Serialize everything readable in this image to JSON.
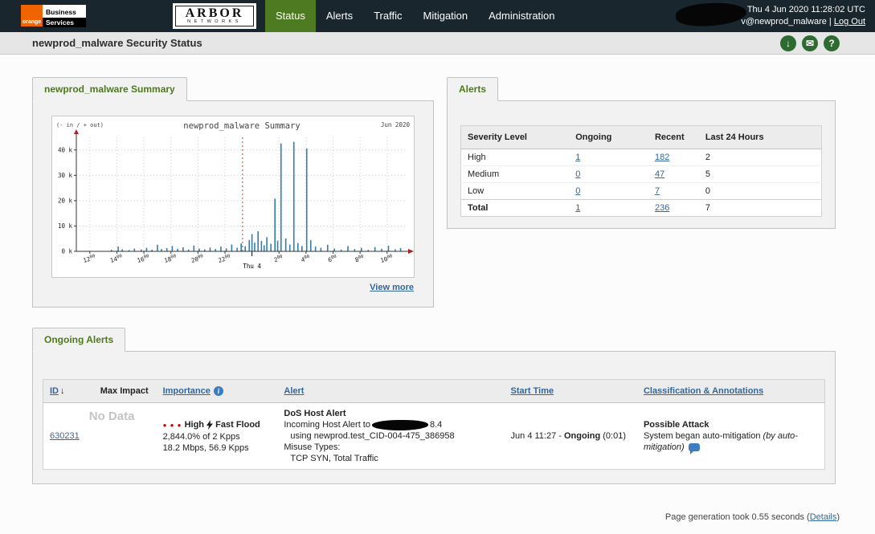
{
  "topbar": {
    "brand": {
      "orange": "orange",
      "business": "Business",
      "services": "Services"
    },
    "arbor": {
      "name": "ARBOR",
      "sub": "NETWORKS"
    },
    "nav": [
      {
        "label": "Status",
        "active": true
      },
      {
        "label": "Alerts",
        "active": false
      },
      {
        "label": "Traffic",
        "active": false
      },
      {
        "label": "Mitigation",
        "active": false
      },
      {
        "label": "Administration",
        "active": false
      }
    ],
    "datetime": "Thu 4 Jun 2020 11:28:02 UTC",
    "user": "v@newprod_malware",
    "separator": " | ",
    "logout": "Log Out"
  },
  "header": {
    "title": "newprod_malware Security Status",
    "icons": [
      {
        "name": "download",
        "glyph": "↓"
      },
      {
        "name": "mail",
        "glyph": "✉"
      },
      {
        "name": "help",
        "glyph": "?"
      }
    ]
  },
  "summary_panel": {
    "tab": "newprod_malware Summary",
    "view_more": "View more"
  },
  "alerts_panel": {
    "tab": "Alerts",
    "headers": [
      "Severity Level",
      "Ongoing",
      "Recent",
      "Last 24 Hours"
    ],
    "rows": [
      {
        "severity": "High",
        "ongoing": "1",
        "recent": "182",
        "last24": "2"
      },
      {
        "severity": "Medium",
        "ongoing": "0",
        "recent": "47",
        "last24": "5"
      },
      {
        "severity": "Low",
        "ongoing": "0",
        "recent": "7",
        "last24": "0"
      },
      {
        "severity": "Total",
        "ongoing": "1",
        "recent": "236",
        "last24": "7"
      }
    ]
  },
  "ongoing_panel": {
    "tab": "Ongoing Alerts",
    "headers": {
      "id": "ID",
      "sort": "↓",
      "max_impact": "Max Impact",
      "importance": "Importance",
      "alert": "Alert",
      "start_time": "Start Time",
      "classification": "Classification & Annotations"
    },
    "row": {
      "id": "630231",
      "max_impact": "No Data",
      "dots": "● ● ●",
      "importance_level": "High",
      "importance_type": "Fast Flood",
      "importance_pct": "2,844.0% of 2 Kpps",
      "importance_rate": "18.2 Mbps, 56.9 Kpps",
      "alert_type": "DoS Host Alert",
      "alert_dest_prefix": "Incoming Host Alert to",
      "alert_dest_suffix": "8.4",
      "alert_resource": "using newprod.test_CID-004-475_386958",
      "alert_misuse_label": "Misuse Types:",
      "alert_misuse": "TCP SYN, Total Traffic",
      "start_prefix": "Jun 4 11:27 - ",
      "start_status": "Ongoing",
      "start_duration": " (0:01)",
      "classification": "Possible Attack",
      "annotation": "System began auto-mitigation ",
      "annotation_by": "(by auto-mitigation)"
    }
  },
  "footer": {
    "prefix": "Page generation took 0.55 seconds (",
    "link": "Details",
    "suffix": ")"
  },
  "chart_data": {
    "type": "bar",
    "title": "newprod_malware Summary",
    "corner_left": "(- in / + out)",
    "corner_right": "Jun 2020",
    "ylim": [
      0,
      45
    ],
    "y_ticks": [
      0,
      10,
      20,
      30,
      40
    ],
    "y_unit": " k",
    "x_domain_hours": [
      11,
      35.5
    ],
    "tick_sup": "00",
    "x_ticks": [
      {
        "h": 12,
        "label": "12"
      },
      {
        "h": 14,
        "label": "14"
      },
      {
        "h": 16,
        "label": "16"
      },
      {
        "h": 18,
        "label": "18"
      },
      {
        "h": 20,
        "label": "20"
      },
      {
        "h": 22,
        "label": "22"
      },
      {
        "h": 26,
        "label": "2"
      },
      {
        "h": 28,
        "label": "4"
      },
      {
        "h": 30,
        "label": "6"
      },
      {
        "h": 32,
        "label": "8"
      },
      {
        "h": 34,
        "label": "10"
      }
    ],
    "day_marker": {
      "h": 24,
      "label": "Thu 4"
    },
    "threshold_hour": 23.3,
    "bar_color": "#2f7fae",
    "threshold_color": "#cc3333",
    "bars": [
      [
        13.6,
        0.6
      ],
      [
        14.1,
        1.9
      ],
      [
        14.4,
        0.8
      ],
      [
        14.9,
        0.5
      ],
      [
        15.3,
        1.1
      ],
      [
        15.8,
        0.7
      ],
      [
        16.2,
        1.4
      ],
      [
        16.6,
        0.6
      ],
      [
        17.0,
        2.6
      ],
      [
        17.3,
        0.9
      ],
      [
        17.7,
        1.3
      ],
      [
        18.1,
        2.1
      ],
      [
        18.5,
        1.0
      ],
      [
        18.9,
        1.6
      ],
      [
        19.3,
        0.7
      ],
      [
        19.7,
        2.3
      ],
      [
        20.1,
        1.1
      ],
      [
        20.5,
        0.8
      ],
      [
        20.9,
        1.5
      ],
      [
        21.3,
        0.9
      ],
      [
        21.7,
        1.9
      ],
      [
        22.1,
        1.2
      ],
      [
        22.5,
        2.7
      ],
      [
        22.9,
        1.4
      ],
      [
        23.2,
        3.1
      ],
      [
        23.5,
        2.0
      ],
      [
        23.8,
        4.5
      ],
      [
        24.0,
        6.8
      ],
      [
        24.2,
        3.4
      ],
      [
        24.45,
        7.9
      ],
      [
        24.7,
        4.1
      ],
      [
        24.9,
        2.4
      ],
      [
        25.1,
        5.6
      ],
      [
        25.4,
        3.0
      ],
      [
        25.7,
        20.8
      ],
      [
        25.9,
        4.2
      ],
      [
        26.15,
        42.6
      ],
      [
        26.5,
        5.1
      ],
      [
        26.8,
        2.7
      ],
      [
        27.1,
        43.2
      ],
      [
        27.4,
        3.3
      ],
      [
        27.7,
        2.1
      ],
      [
        28.05,
        40.6
      ],
      [
        28.35,
        4.4
      ],
      [
        28.7,
        1.9
      ],
      [
        29.1,
        1.4
      ],
      [
        29.6,
        2.6
      ],
      [
        30.1,
        1.1
      ],
      [
        30.6,
        0.7
      ],
      [
        31.1,
        2.1
      ],
      [
        31.6,
        0.9
      ],
      [
        32.1,
        1.4
      ],
      [
        32.6,
        0.6
      ],
      [
        33.1,
        1.7
      ],
      [
        33.6,
        1.0
      ],
      [
        34.1,
        2.2
      ],
      [
        34.6,
        0.8
      ],
      [
        35.0,
        1.3
      ]
    ]
  }
}
